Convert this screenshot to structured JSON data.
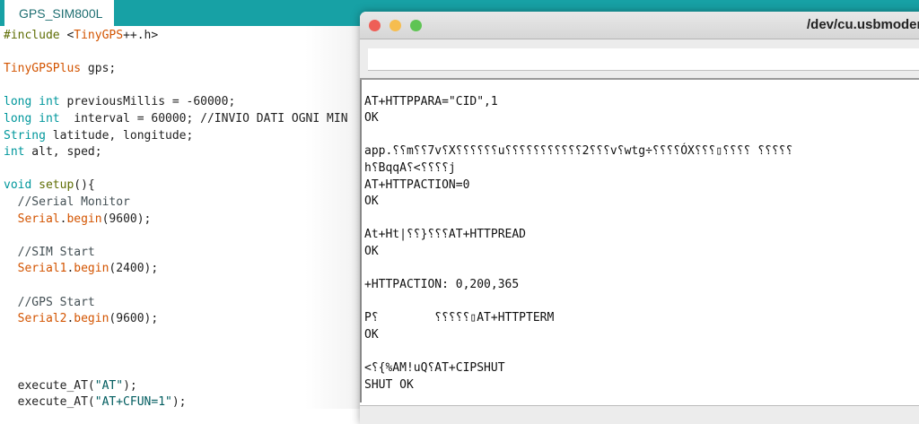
{
  "editor": {
    "tab_label": "GPS_SIM800L",
    "lines": [
      {
        "row": 0,
        "tokens": [
          [
            "fn",
            "#include "
          ],
          [
            "",
            "<"
          ],
          [
            "cls",
            "TinyGPS"
          ],
          [
            "",
            "++.h>"
          ]
        ]
      },
      {
        "row": 2,
        "tokens": [
          [
            "cls",
            "TinyGPSPlus"
          ],
          [
            "",
            " gps;"
          ]
        ]
      },
      {
        "row": 4,
        "tokens": [
          [
            "kw",
            "long int"
          ],
          [
            "",
            " previousMillis = -60000;"
          ]
        ]
      },
      {
        "row": 5,
        "tokens": [
          [
            "kw",
            "long int"
          ],
          [
            "",
            "  interval = 60000; //INVIO DATI OGNI MIN"
          ]
        ]
      },
      {
        "row": 6,
        "tokens": [
          [
            "kw",
            "String"
          ],
          [
            "",
            " latitude, longitude;"
          ]
        ]
      },
      {
        "row": 7,
        "tokens": [
          [
            "kw",
            "int"
          ],
          [
            "",
            " alt, sped;"
          ]
        ]
      },
      {
        "row": 9,
        "tokens": [
          [
            "kw",
            "void"
          ],
          [
            "",
            " "
          ],
          [
            "fn",
            "setup"
          ],
          [
            "",
            "(){"
          ]
        ]
      },
      {
        "row": 10,
        "tokens": [
          [
            "cm",
            "  //Serial Monitor"
          ]
        ]
      },
      {
        "row": 11,
        "tokens": [
          [
            "",
            "  "
          ],
          [
            "cls",
            "Serial"
          ],
          [
            "",
            "."
          ],
          [
            "cls",
            "begin"
          ],
          [
            "",
            "(9600);"
          ]
        ]
      },
      {
        "row": 13,
        "tokens": [
          [
            "cm",
            "  //SIM Start"
          ]
        ]
      },
      {
        "row": 14,
        "tokens": [
          [
            "",
            "  "
          ],
          [
            "cls",
            "Serial1"
          ],
          [
            "",
            "."
          ],
          [
            "cls",
            "begin"
          ],
          [
            "",
            "(2400);"
          ]
        ]
      },
      {
        "row": 16,
        "tokens": [
          [
            "cm",
            "  //GPS Start"
          ]
        ]
      },
      {
        "row": 17,
        "tokens": [
          [
            "",
            "  "
          ],
          [
            "cls",
            "Serial2"
          ],
          [
            "",
            "."
          ],
          [
            "cls",
            "begin"
          ],
          [
            "",
            "(9600);"
          ]
        ]
      },
      {
        "row": 21,
        "tokens": [
          [
            "",
            "  execute_AT("
          ],
          [
            "str",
            "\"AT\""
          ],
          [
            "",
            ");"
          ]
        ]
      },
      {
        "row": 22,
        "tokens": [
          [
            "",
            "  execute_AT("
          ],
          [
            "str",
            "\"AT+CFUN=1\""
          ],
          [
            "",
            ");"
          ]
        ]
      }
    ]
  },
  "serial_monitor": {
    "title": "/dev/cu.usbmodem",
    "input_value": "",
    "output_lines": [
      {
        "row": 1,
        "text": "AT+HTTPPARA=\"CID\",1"
      },
      {
        "row": 2,
        "text": "OK"
      },
      {
        "row": 4,
        "text": "app.⸮⸮m⸮⸮7v⸮X⸮⸮⸮⸮⸮⸮u⸮⸮⸮⸮⸮⸮⸮⸮⸮⸮⸮2⸮⸮⸮v⸮wtg÷⸮⸮⸮⸮ÓX⸮⸮⸮▯⸮⸮⸮⸮ ⸮⸮⸮⸮⸮"
      },
      {
        "row": 5,
        "text": "h⸮BqqA⸮<⸮⸮⸮⸮j"
      },
      {
        "row": 6,
        "text": "AT+HTTPACTION=0"
      },
      {
        "row": 7,
        "text": "OK"
      },
      {
        "row": 9,
        "text": "At+Ht|⸮⸮}⸮⸮⸮AT+HTTPREAD"
      },
      {
        "row": 10,
        "text": "OK"
      },
      {
        "row": 12,
        "text": "+HTTPACTION: 0,200,365"
      },
      {
        "row": 14,
        "text": "P⸮        ⸮⸮⸮⸮⸮▯AT+HTTPTERM"
      },
      {
        "row": 15,
        "text": "OK"
      },
      {
        "row": 17,
        "text": "<⸮{%AM!uQ⸮AT+CIPSHUT"
      },
      {
        "row": 18,
        "text": "SHUT OK"
      }
    ]
  },
  "colors": {
    "header": "#17a1a5",
    "close": "#ee5f57",
    "minimize": "#f6bd4f",
    "zoom": "#5fc454"
  }
}
